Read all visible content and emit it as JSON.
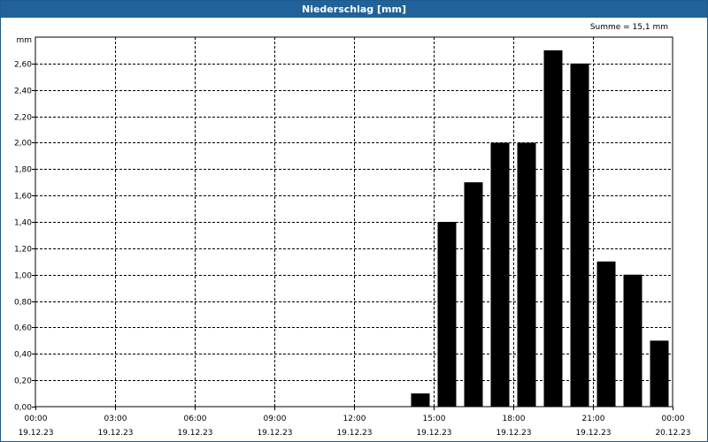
{
  "window": {
    "title": "Niederschlag [mm]"
  },
  "summary": "Summe = 15,1 mm",
  "colors": {
    "titlebar": "#21629a",
    "bars": "#000000",
    "grid": "#000000"
  },
  "chart_data": {
    "type": "bar",
    "title": "Niederschlag [mm]",
    "ylabel": "mm",
    "xlabel": "",
    "ylim": [
      0,
      2.8
    ],
    "grid": true,
    "yticks": [
      "0,00",
      "0,20",
      "0,40",
      "0,60",
      "0,80",
      "1,00",
      "1,20",
      "1,40",
      "1,60",
      "1,80",
      "2,00",
      "2,20",
      "2,40",
      "2,60"
    ],
    "xticks": [
      {
        "time": "00:00",
        "date": "19.12.23"
      },
      {
        "time": "03:00",
        "date": "19.12.23"
      },
      {
        "time": "06:00",
        "date": "19.12.23"
      },
      {
        "time": "09:00",
        "date": "19.12.23"
      },
      {
        "time": "12:00",
        "date": "19.12.23"
      },
      {
        "time": "15:00",
        "date": "19.12.23"
      },
      {
        "time": "18:00",
        "date": "19.12.23"
      },
      {
        "time": "21:00",
        "date": "19.12.23"
      },
      {
        "time": "00:00",
        "date": "20.12.23"
      }
    ],
    "x_range": [
      "19.12.23 00:00",
      "20.12.23 00:00"
    ],
    "bars": [
      {
        "hour": "14:00-15:00",
        "value": 0.1
      },
      {
        "hour": "15:00-16:00",
        "value": 1.4
      },
      {
        "hour": "16:00-17:00",
        "value": 1.7
      },
      {
        "hour": "17:00-18:00",
        "value": 2.0
      },
      {
        "hour": "18:00-19:00",
        "value": 2.0
      },
      {
        "hour": "19:00-20:00",
        "value": 2.7
      },
      {
        "hour": "20:00-21:00",
        "value": 2.6
      },
      {
        "hour": "21:00-22:00",
        "value": 1.1
      },
      {
        "hour": "22:00-23:00",
        "value": 1.0
      },
      {
        "hour": "23:00-24:00",
        "value": 0.5
      }
    ]
  }
}
